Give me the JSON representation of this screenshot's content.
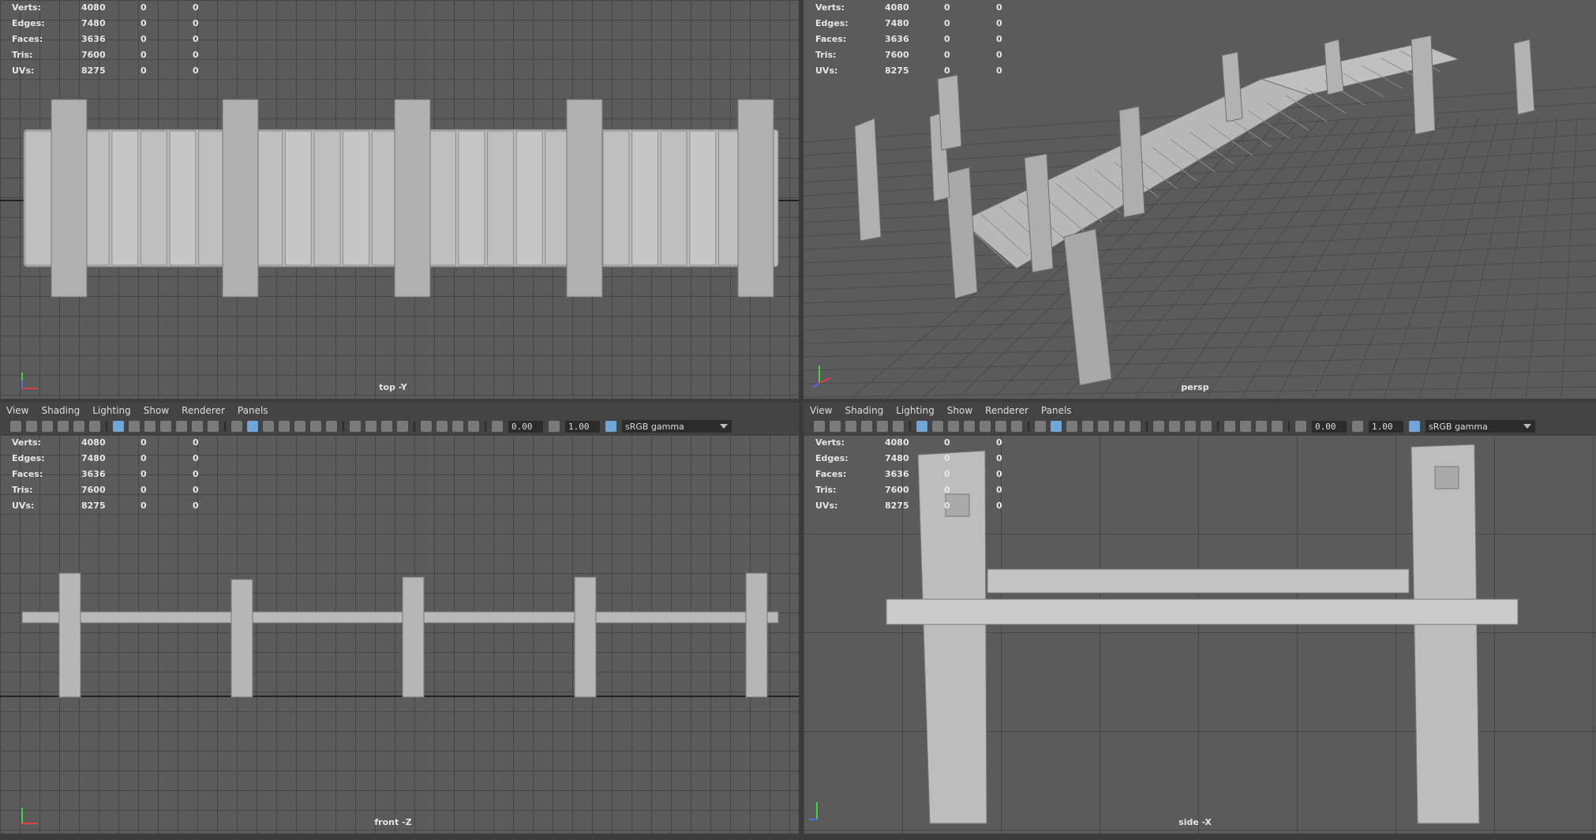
{
  "hud": {
    "rows": [
      {
        "label": "Verts:",
        "value": "4080",
        "a": "0",
        "b": "0"
      },
      {
        "label": "Edges:",
        "value": "7480",
        "a": "0",
        "b": "0"
      },
      {
        "label": "Faces:",
        "value": "3636",
        "a": "0",
        "b": "0"
      },
      {
        "label": "Tris:",
        "value": "7600",
        "a": "0",
        "b": "0"
      },
      {
        "label": "UVs:",
        "value": "8275",
        "a": "0",
        "b": "0"
      }
    ]
  },
  "viewports": {
    "top": {
      "label": "top -Y"
    },
    "persp": {
      "label": "persp"
    },
    "front": {
      "label": "front -Z"
    },
    "side": {
      "label": "side -X"
    }
  },
  "menu": {
    "items": [
      "View",
      "Shading",
      "Lighting",
      "Show",
      "Renderer",
      "Panels"
    ]
  },
  "toolbar": {
    "exposure_value": "0.00",
    "gamma_value": "1.00",
    "color_space": "sRGB gamma"
  },
  "icons": [
    "camera-icon",
    "grid-icon",
    "wireframe-icon",
    "smooth-shade-icon",
    "texture-icon",
    "light-icon",
    "xray-icon",
    "exposure-icon",
    "gamma-icon",
    "color-space-icon"
  ]
}
